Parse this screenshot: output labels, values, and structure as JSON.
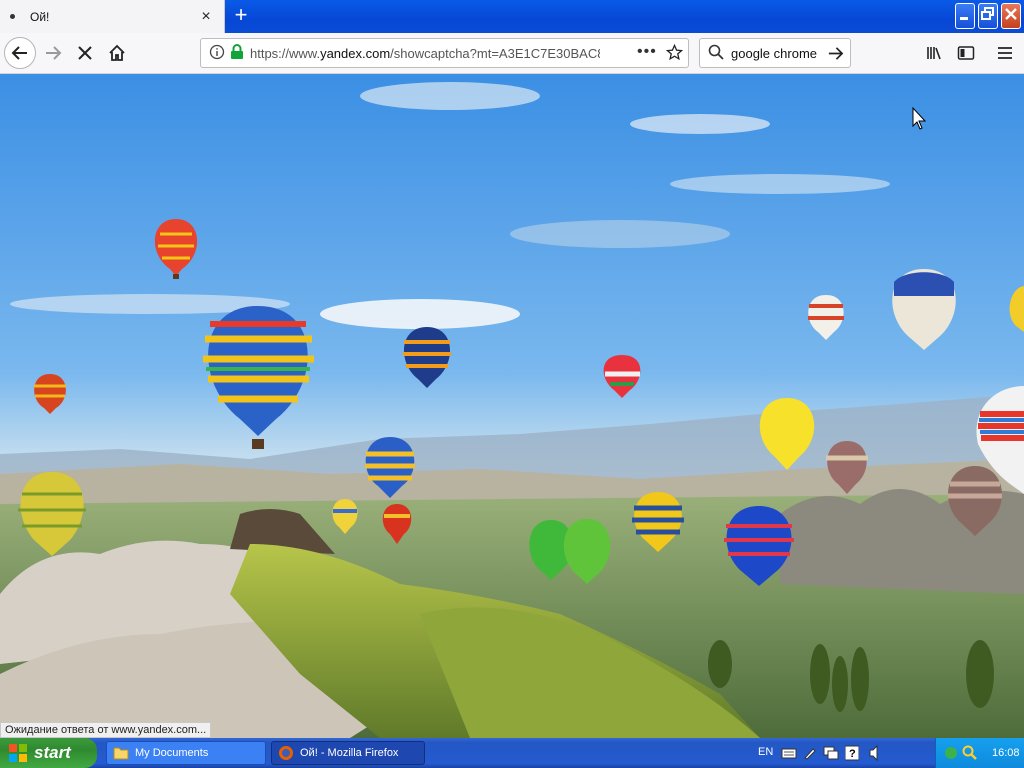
{
  "browser": {
    "tab_title": "Ой!",
    "url_prefix": "https://www.",
    "url_domain": "yandex.com",
    "url_rest": "/showcaptcha?mt=A3E1C7E30BAC8",
    "search_value": "google chrome",
    "status_text": "Ожидание ответа от www.yandex.com..."
  },
  "taskbar": {
    "start_label": "start",
    "items": [
      {
        "label": "My Documents"
      },
      {
        "label": "Ой! - Mozilla Firefox"
      }
    ],
    "lang": "EN",
    "clock": "16:08"
  },
  "icons": [
    "tab-dot-icon",
    "close-tab-icon",
    "new-tab-icon",
    "minimize-icon",
    "maximize-icon",
    "window-close-icon",
    "back-icon",
    "forward-icon",
    "stop-icon",
    "home-icon",
    "info-icon",
    "lock-icon",
    "page-actions-icon",
    "bookmark-star-icon",
    "search-icon",
    "search-go-icon",
    "library-icon",
    "sidebar-icon",
    "menu-icon",
    "windows-logo-icon",
    "folder-icon",
    "firefox-icon",
    "keyboard-icon",
    "network-icon",
    "help-icon",
    "volume-icon",
    "security-icon"
  ],
  "colors": {
    "titlebar": "#0747d6",
    "taskbar": "#245bd0",
    "start_button": "#3c9a3c",
    "tray": "#0f8adc",
    "lock": "#12a33a",
    "sky": "#4f9ee8"
  }
}
